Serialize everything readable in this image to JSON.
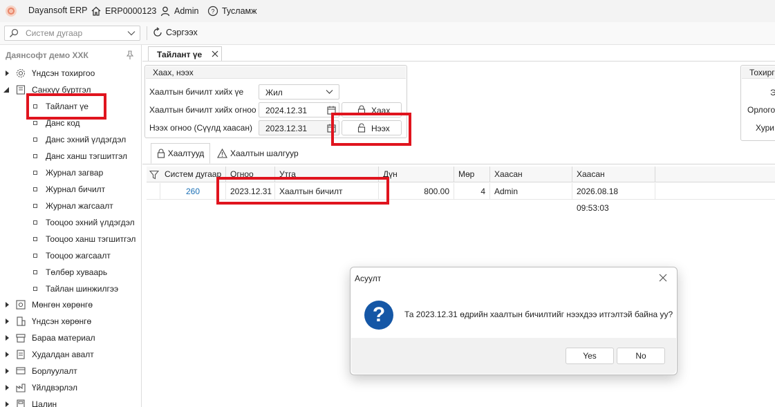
{
  "titlebar": {
    "app_name": "Dayansoft ERP",
    "company_code": "ERP0000123",
    "user": "Admin",
    "help": "Тусламж"
  },
  "toolbar": {
    "search_placeholder": "Систем дугаар",
    "refresh_label": "Сэргээх"
  },
  "sidebar": {
    "header": "Даянсофт демо ХХК",
    "groups": [
      {
        "label": "Үндсэн тохиргоо",
        "icon": "gear-icon",
        "expanded": false
      },
      {
        "label": "Санхүү бүртгэл",
        "icon": "book-icon",
        "expanded": true,
        "items": [
          "Тайлант үе",
          "Данс код",
          "Данс эхний үлдэгдэл",
          "Данс ханш тэгшитгэл",
          "Журнал загвар",
          "Журнал бичилт",
          "Журнал жагсаалт",
          "Тооцоо эхний үлдэгдэл",
          "Тооцоо ханш тэгшитгэл",
          "Тооцоо жагсаалт",
          "Төлбөр хуваарь",
          "Тайлан шинжилгээ"
        ]
      },
      {
        "label": "Мөнгөн хөрөнгө",
        "icon": "safe-icon",
        "expanded": false
      },
      {
        "label": "Үндсэн хөрөнгө",
        "icon": "building-icon",
        "expanded": false
      },
      {
        "label": "Бараа материал",
        "icon": "box-icon",
        "expanded": false
      },
      {
        "label": "Худалдан авалт",
        "icon": "cart-icon",
        "expanded": false
      },
      {
        "label": "Борлуулалт",
        "icon": "sale-icon",
        "expanded": false
      },
      {
        "label": "Үйлдвэрлэл",
        "icon": "factory-icon",
        "expanded": false
      },
      {
        "label": "Цалин",
        "icon": "salary-icon",
        "expanded": false
      }
    ]
  },
  "tab": {
    "title": "Тайлант үе"
  },
  "close_open_group": {
    "title": "Хаах, нээх",
    "period_label": "Хаалтын бичилт хийх үе",
    "period_value": "Жил",
    "close_date_label": "Хаалтын бичилт хийх огноо",
    "close_date_value": "2024.12.31",
    "close_button": "Хаах",
    "open_date_label": "Нээх огноо (Сүүлд хаасан)",
    "open_date_value": "2023.12.31",
    "open_button": "Нээх"
  },
  "settings_group": {
    "title": "Тохирг",
    "lines": [
      "Э",
      "Орлого",
      "Хури"
    ]
  },
  "inner_tabs": {
    "closings": "Хаалтууд",
    "checks": "Хаалтын шалгуур"
  },
  "grid": {
    "columns": [
      "Систем дугаар",
      "Огноо",
      "Утга",
      "Дүн",
      "Мөр",
      "Хаасан",
      "Хаасан"
    ],
    "rows": [
      {
        "system_no": "260",
        "date": "2023.12.31",
        "description": "Хаалтын бичилт",
        "amount": "800.00",
        "lines": "4",
        "closed_by": "Admin",
        "closed_at": "2026.08.18 09:53:03"
      }
    ]
  },
  "dialog": {
    "title": "Асуулт",
    "message": "Та 2023.12.31 өдрийн хаалтын бичилтийг нээхдээ итгэлтэй байна уу?",
    "yes": "Yes",
    "no": "No"
  },
  "colors": {
    "highlight": "#e0141e",
    "link": "#1a6fb5",
    "dialog_icon": "#1557a6"
  }
}
